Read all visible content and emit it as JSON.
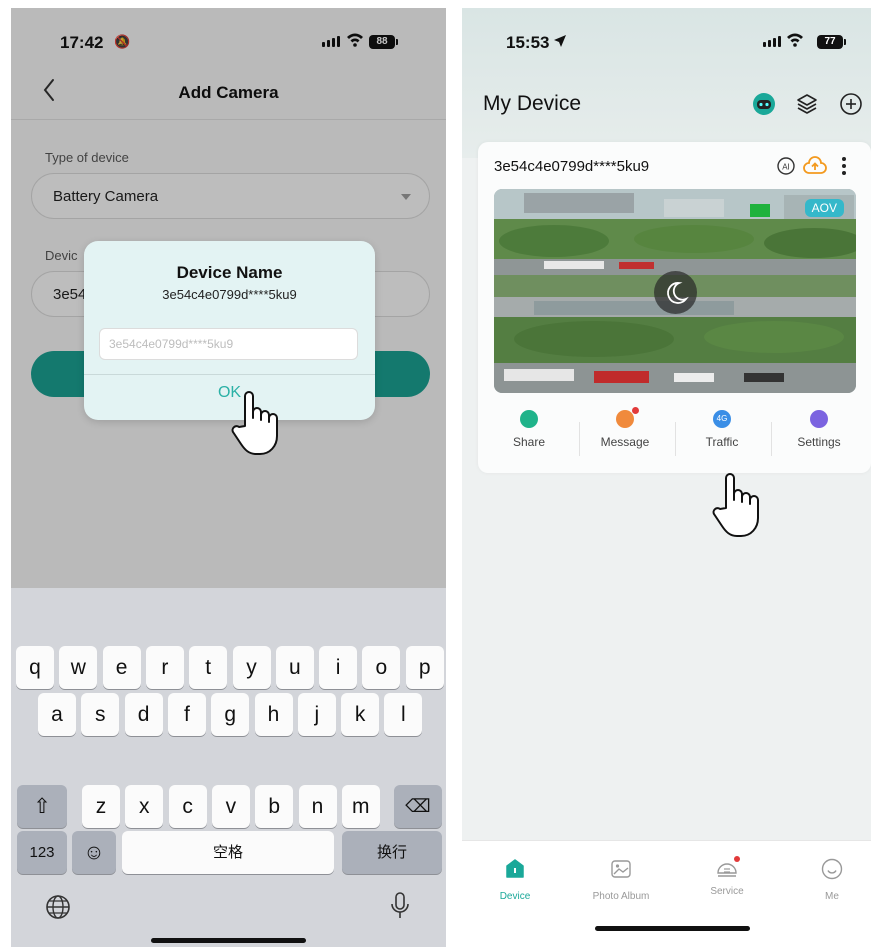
{
  "left": {
    "status": {
      "time": "17:42",
      "battery": "88"
    },
    "nav": {
      "title": "Add Camera"
    },
    "form": {
      "type_label": "Type of device",
      "type_value": "Battery Camera",
      "name_label_partial": "Devic",
      "name_value_partial": "3e54"
    },
    "dialog": {
      "title": "Device Name",
      "subtitle": "3e54c4e0799d****5ku9",
      "input_placeholder": "3e54c4e0799d****5ku9",
      "ok_label": "OK"
    },
    "keyboard": {
      "row1": [
        "q",
        "w",
        "e",
        "r",
        "t",
        "y",
        "u",
        "i",
        "o",
        "p"
      ],
      "row2": [
        "a",
        "s",
        "d",
        "f",
        "g",
        "h",
        "j",
        "k",
        "l"
      ],
      "row3": [
        "z",
        "x",
        "c",
        "v",
        "b",
        "n",
        "m"
      ],
      "numbers_key": "123",
      "space_label": "空格",
      "return_label": "换行"
    }
  },
  "right": {
    "status": {
      "time": "15:53",
      "battery": "77"
    },
    "header": {
      "title": "My Device"
    },
    "device": {
      "name": "3e54c4e0799d****5ku9",
      "badge": "AOV"
    },
    "actions": [
      {
        "label": "Share",
        "icon": "share-icon",
        "color": "#1fb38a"
      },
      {
        "label": "Message",
        "icon": "message-icon",
        "color": "#f08a3c"
      },
      {
        "label": "Traffic",
        "icon": "4g-icon",
        "color": "#3a8ee6",
        "icon_text": "4G"
      },
      {
        "label": "Settings",
        "icon": "settings-icon",
        "color": "#7b63e0"
      }
    ],
    "tabs": [
      {
        "label": "Device",
        "icon": "device-icon",
        "active": true
      },
      {
        "label": "Photo Album",
        "icon": "photo-album-icon",
        "active": false
      },
      {
        "label": "Service",
        "icon": "service-icon",
        "active": false
      },
      {
        "label": "Me",
        "icon": "me-icon",
        "active": false
      }
    ]
  },
  "colors": {
    "accent": "#1a9b8e",
    "active_tab": "#1aa899",
    "aov_badge": "#35b8ca"
  }
}
